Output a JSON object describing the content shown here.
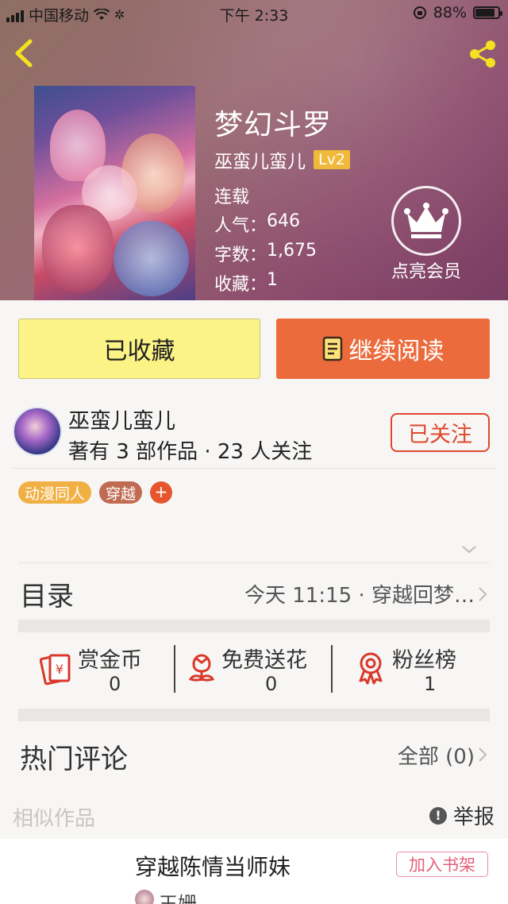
{
  "status_bar": {
    "carrier": "中国移动",
    "time": "下午 2:33",
    "battery": "88%"
  },
  "book": {
    "title": "梦幻斗罗",
    "author": "巫蛮儿蛮儿",
    "level": "Lv2",
    "status": "连载",
    "popularity_label": "人气：",
    "popularity": "646",
    "words_label": "字数：",
    "words": "1,675",
    "favorites_label": "收藏：",
    "favorites": "1"
  },
  "vip": {
    "label": "点亮会员"
  },
  "actions": {
    "collected_label": "已收藏",
    "read_label": "继续阅读"
  },
  "author_card": {
    "name": "巫蛮儿蛮儿",
    "stats": "著有 3 部作品 · 23 人关注",
    "follow_label": "已关注"
  },
  "tags": [
    "动漫同人",
    "穿越"
  ],
  "tag_add": "+",
  "toc": {
    "label": "目录",
    "latest": "今天 11:15 · 穿越回梦…"
  },
  "rewards": [
    {
      "label": "赏金币",
      "value": "0",
      "icon": "red-envelope-icon"
    },
    {
      "label": "免费送花",
      "value": "0",
      "icon": "flower-icon"
    },
    {
      "label": "粉丝榜",
      "value": "1",
      "icon": "award-ribbon-icon"
    }
  ],
  "comments": {
    "label": "热门评论",
    "all_label": "全部 (0)"
  },
  "similar": {
    "label": "相似作品",
    "report_label": "举报",
    "report_icon": "!"
  },
  "recommendation": {
    "title": "穿越陈情当师妹",
    "add_label": "加入书架",
    "author": "王姗"
  },
  "colors": {
    "accent_orange": "#ec6b3c",
    "collected_yellow": "#fbf385",
    "follow_red": "#e0472d"
  }
}
